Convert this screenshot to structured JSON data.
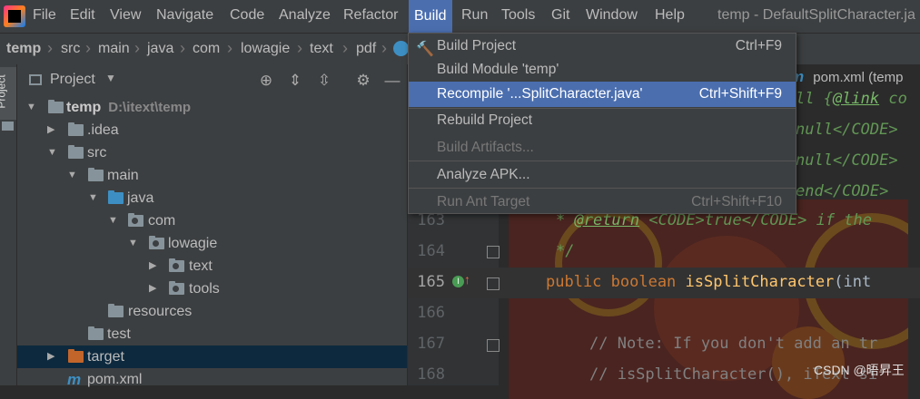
{
  "menubar": {
    "items": [
      "File",
      "Edit",
      "View",
      "Navigate",
      "Code",
      "Analyze",
      "Refactor",
      "Build",
      "Run",
      "Tools",
      "Git",
      "Window",
      "Help"
    ],
    "window_title": "temp - DefaultSplitCharacter.ja"
  },
  "breadcrumb": [
    "temp",
    "src",
    "main",
    "java",
    "com",
    "lowagie",
    "text",
    "pdf"
  ],
  "project_panel": {
    "title": "Project",
    "tree": [
      {
        "label": "temp",
        "path": "D:\\itext\\temp"
      },
      {
        "label": ".idea"
      },
      {
        "label": "src"
      },
      {
        "label": "main"
      },
      {
        "label": "java"
      },
      {
        "label": "com"
      },
      {
        "label": "lowagie"
      },
      {
        "label": "text"
      },
      {
        "label": "tools"
      },
      {
        "label": "resources"
      },
      {
        "label": "test"
      },
      {
        "label": "target"
      },
      {
        "label": "pom.xml"
      }
    ],
    "vertical_tab": "Project"
  },
  "build_menu": {
    "items": [
      {
        "label": "Build Project",
        "shortcut": "Ctrl+F9",
        "state": "normal"
      },
      {
        "label": "Build Module 'temp'",
        "shortcut": "",
        "state": "normal"
      },
      {
        "label": "Recompile '...SplitCharacter.java'",
        "shortcut": "Ctrl+Shift+F9",
        "state": "highlighted"
      },
      {
        "label": "Rebuild Project",
        "shortcut": "",
        "state": "normal"
      },
      {
        "label": "Build Artifacts...",
        "shortcut": "",
        "state": "disabled"
      },
      {
        "label": "Analyze APK...",
        "shortcut": "",
        "state": "normal"
      },
      {
        "label": "Run Ant Target",
        "shortcut": "Ctrl+Shift+F10",
        "state": "disabled"
      }
    ]
  },
  "editor": {
    "tab": "pom.xml (temp",
    "line_numbers": [
      "163",
      "164",
      "165",
      "166",
      "167",
      "168"
    ],
    "partial_lines": {
      "l1_link": "@link",
      "l1_rest": "ll {",
      "l1_after": " co",
      "l2": "null</CODE>",
      "l3": "null</CODE>",
      "l4": "end</CODE>",
      "l5_star": "* ",
      "l5_tag": "@return",
      "l5_rest": " <CODE>true</CODE> if the",
      "l6": "*/",
      "l7_kw": "public boolean ",
      "l7_fn": "isSplitCharacter",
      "l7_rest": "(int",
      "l8": "// Note: If you don't add an tr",
      "l9": "// isSplitCharacter(), iText si"
    }
  },
  "watermark": "CSDN @晤昇王",
  "colors": {
    "accent": "#4b6eaf",
    "background": "#2b2b2b",
    "panel": "#3c3f41"
  }
}
